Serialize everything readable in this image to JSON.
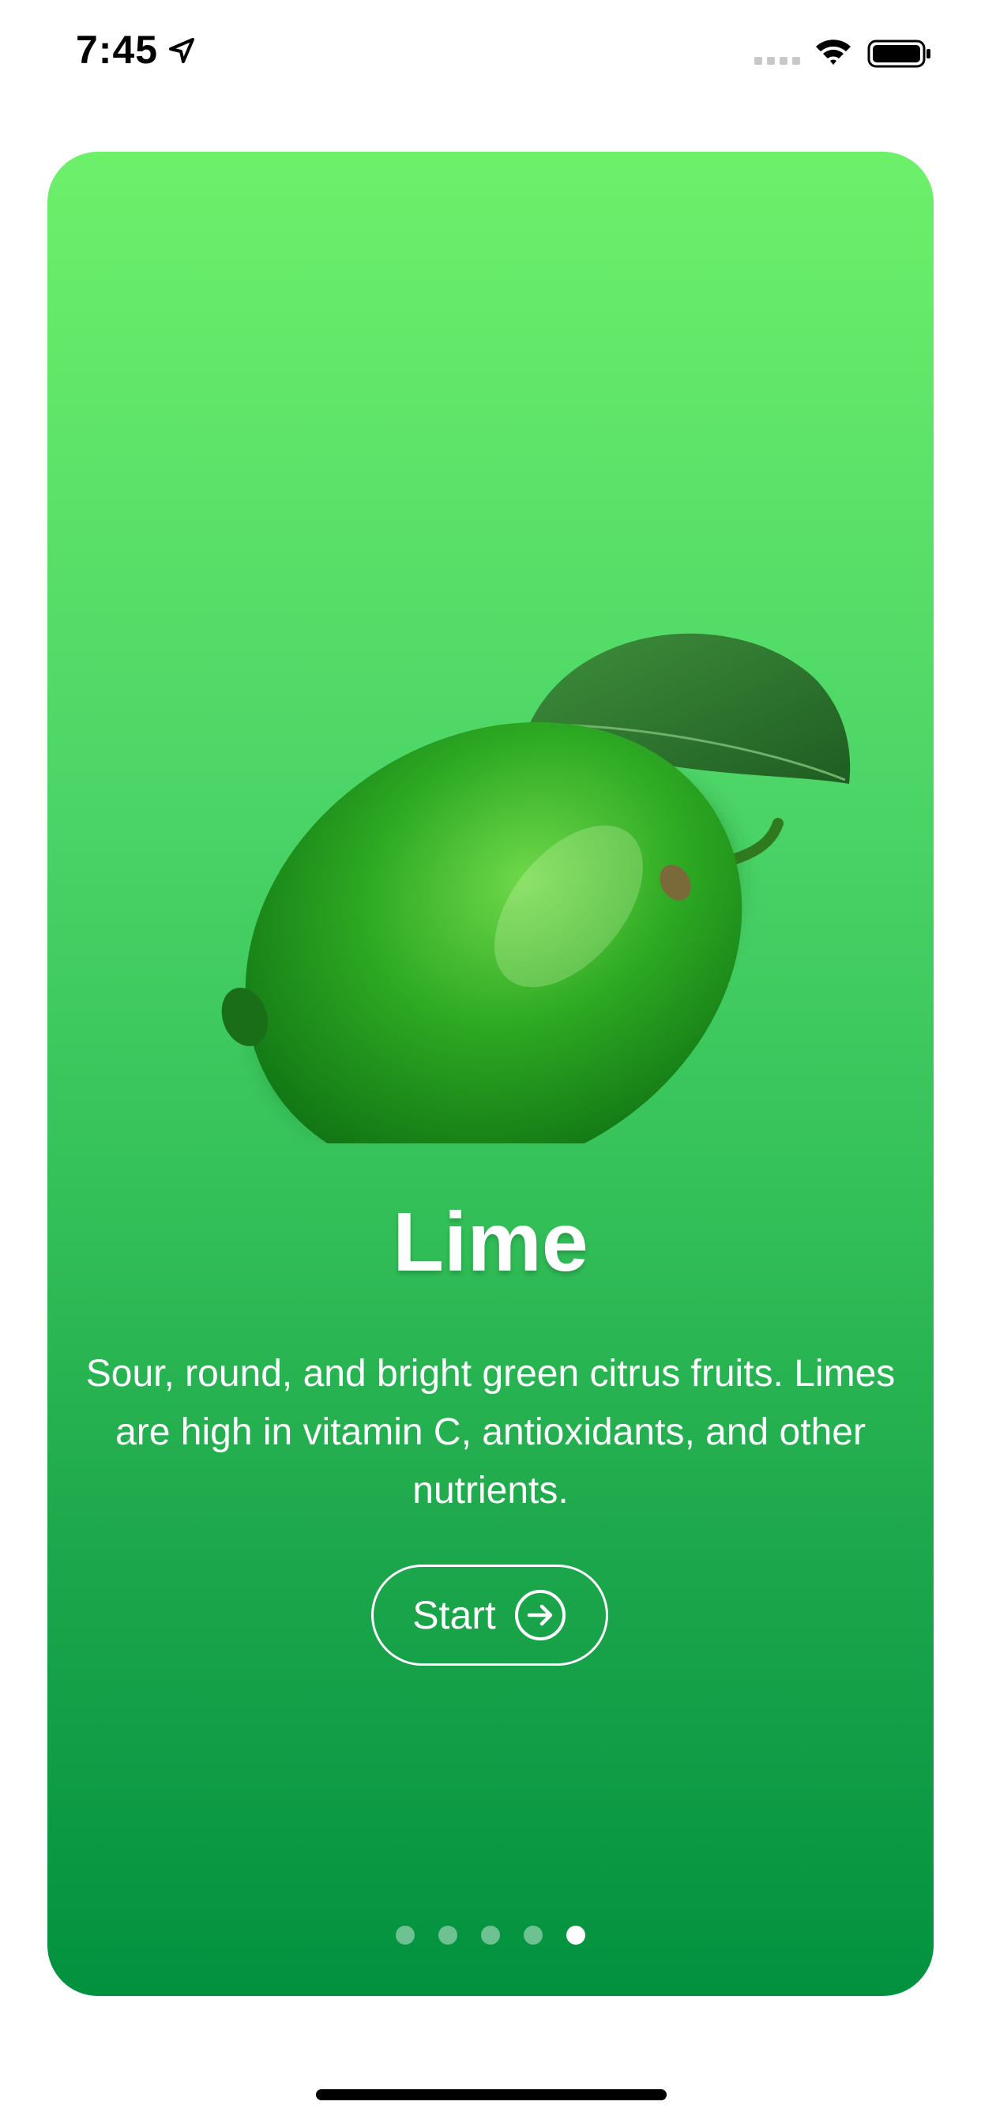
{
  "status_bar": {
    "time": "7:45",
    "location_icon": "location-arrow-icon",
    "signal_icon": "cellular-signal-icon",
    "wifi_icon": "wifi-icon",
    "battery_icon": "battery-icon"
  },
  "card": {
    "gradient_top": "#6df06a",
    "gradient_bottom": "#02913f",
    "image_icon": "lime-fruit-illustration",
    "title": "Lime",
    "description": "Sour, round, and bright green citrus fruits. Limes are high in vitamin C, antioxidants, and other nutrients.",
    "button": {
      "label": "Start",
      "icon": "arrow-right-circle-icon"
    },
    "pagination": {
      "total": 5,
      "active_index": 4
    }
  }
}
